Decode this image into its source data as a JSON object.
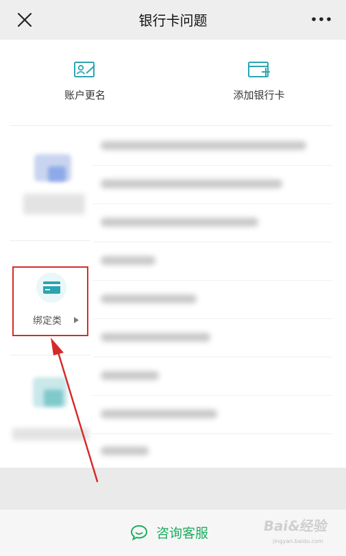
{
  "header": {
    "title": "银行卡问题",
    "close_icon": "close-icon",
    "more_icon": "more-dots-icon"
  },
  "quick_actions": [
    {
      "label": "账户更名",
      "icon": "id-card-edit-icon"
    },
    {
      "label": "添加银行卡",
      "icon": "add-card-icon"
    }
  ],
  "categories": {
    "binding": {
      "label": "绑定类",
      "icon": "bank-card-icon"
    }
  },
  "footer": {
    "service_label": "咨询客服",
    "service_icon": "chat-bubble-icon"
  },
  "watermark": {
    "text": "Bai&经验",
    "sub": "jingyan.baidu.com"
  },
  "colors": {
    "accent_green": "#1aad5e",
    "icon_teal": "#2aa5b0",
    "highlight_red": "#d62a2a",
    "header_bg": "#eeeeee"
  }
}
